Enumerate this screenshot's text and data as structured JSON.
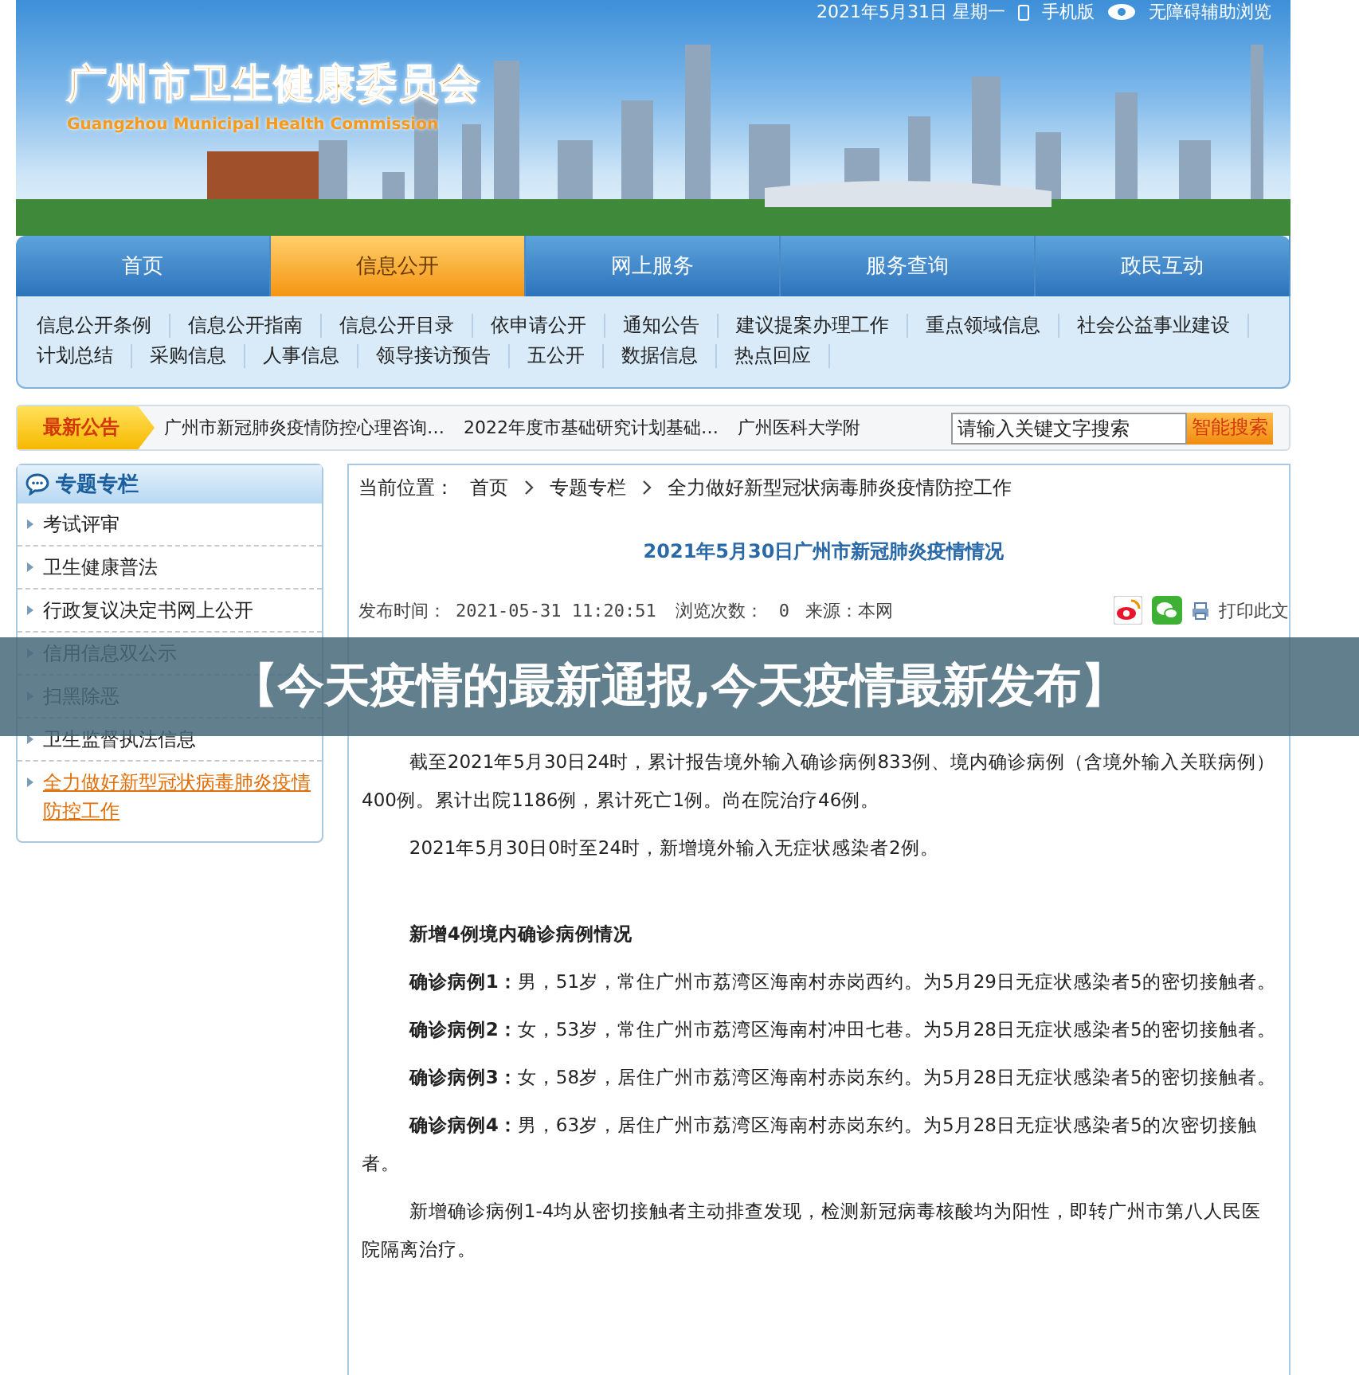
{
  "top_bar": {
    "date": "2021年5月31日 星期一",
    "mobile": "手机版",
    "accessibility": "无障碍辅助浏览"
  },
  "header": {
    "logo_title": "广州市卫生健康委员会",
    "logo_subtitle": "Guangzhou Municipal Health Commission"
  },
  "nav": [
    {
      "label": "首页",
      "selected": false
    },
    {
      "label": "信息公开",
      "selected": true
    },
    {
      "label": "网上服务",
      "selected": false
    },
    {
      "label": "服务查询",
      "selected": false
    },
    {
      "label": "政民互动",
      "selected": false
    }
  ],
  "sub_nav": [
    "信息公开条例",
    "信息公开指南",
    "信息公开目录",
    "依申请公开",
    "通知公告",
    "建议提案办理工作",
    "重点领域信息",
    "社会公益事业建设",
    "计划总结",
    "采购信息",
    "人事信息",
    "领导接访预告",
    "五公开",
    "数据信息",
    "热点回应"
  ],
  "notice": {
    "label": "最新公告",
    "items": [
      "广州市新冠肺炎疫情防控心理咨询…",
      "2022年度市基础研究计划基础…",
      "广州医科大学附"
    ],
    "search_placeholder": "请输入关键文字搜索",
    "search_button": "智能搜索"
  },
  "sidebar": {
    "title": "专题专栏",
    "items": [
      {
        "label": "考试评审",
        "selected": false
      },
      {
        "label": "卫生健康普法",
        "selected": false
      },
      {
        "label": "行政复议决定书网上公开",
        "selected": false
      },
      {
        "label": "信用信息双公示",
        "selected": false
      },
      {
        "label": "扫黑除恶",
        "selected": false
      },
      {
        "label": "卫生监督执法信息",
        "selected": false
      },
      {
        "label": "全力做好新型冠状病毒肺炎疫情防控工作",
        "selected": true
      }
    ]
  },
  "article": {
    "breadcrumb": {
      "label": "当前位置：",
      "items": [
        "首页",
        "专题专栏",
        "全力做好新型冠状病毒肺炎疫情防控工作"
      ]
    },
    "title": "2021年5月30日广州市新冠肺炎疫情情况",
    "meta": {
      "time_label": "发布时间：",
      "time": "2021-05-31 11:20:51",
      "views_label": "浏览次数：",
      "views": "0",
      "source": "来源：本网",
      "print": "打印此文"
    },
    "paragraphs": [
      {
        "kind": "gap"
      },
      {
        "kind": "text",
        "text": "截至2021年5月30日24时，累计报告境外输入确诊病例833例、境内确诊病例（含境外输入关联病例）400例。累计出院1186例，累计死亡1例。尚在院治疗46例。"
      },
      {
        "kind": "text",
        "text": "2021年5月30日0时至24时，新增境外输入无症状感染者2例。"
      },
      {
        "kind": "heading",
        "text": "新增4例境内确诊病例情况"
      },
      {
        "kind": "text",
        "text": "**确诊病例1：**男，51岁，常住广州市荔湾区海南村赤岗西约。为5月29日无症状感染者5的密切接触者。"
      },
      {
        "kind": "text",
        "text": "**确诊病例2：**女，53岁，常住广州市荔湾区海南村冲田七巷。为5月28日无症状感染者5的密切接触者。"
      },
      {
        "kind": "text",
        "text": "**确诊病例3：**女，58岁，居住广州市荔湾区海南村赤岗东约。为5月28日无症状感染者5的密切接触者。"
      },
      {
        "kind": "text",
        "text": "**确诊病例4：**男，63岁，居住广州市荔湾区海南村赤岗东约。为5月28日无症状感染者5的次密切接触者。"
      },
      {
        "kind": "text",
        "text": "新增确诊病例1-4均从密切接触者主动排查发现，检测新冠病毒核酸均为阳性，即转广州市第八人民医院隔离治疗。"
      }
    ]
  },
  "overlay_banner": "【今天疫情的最新通报,今天疫情最新发布】"
}
